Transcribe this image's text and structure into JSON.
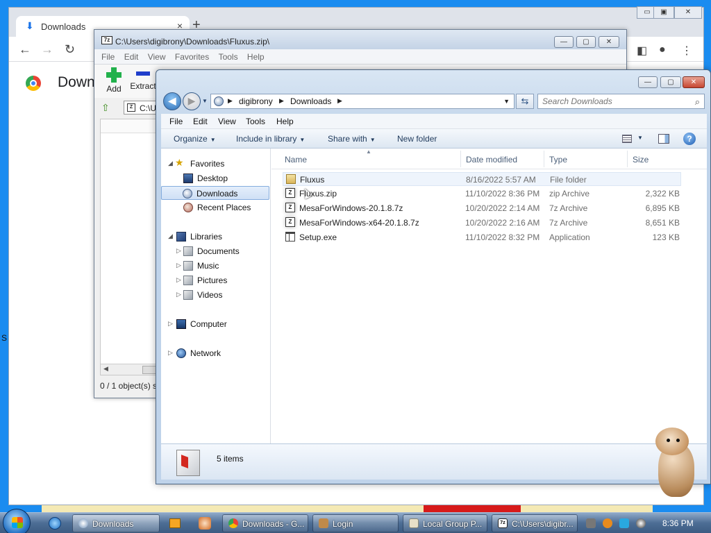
{
  "chrome": {
    "tab_title": "Downloads",
    "tab_close": "×",
    "new_tab": "+",
    "back": "←",
    "forward": "→",
    "reload": "↻",
    "heading": "Downloads",
    "win_min": "▭",
    "win_max": "▣",
    "win_close": "✕",
    "menu_dots": "⋮"
  },
  "zip7": {
    "title": "C:\\Users\\digibrony\\Downloads\\Fluxus.zip\\",
    "icon_label": "7z",
    "menu": [
      "File",
      "Edit",
      "View",
      "Favorites",
      "Tools",
      "Help"
    ],
    "add_label": "Add",
    "extract_label": "Extract",
    "address": "C:\\U",
    "status": "0 / 1 object(s) s"
  },
  "explorer": {
    "window_min": "—",
    "window_max": "▢",
    "window_close": "✕",
    "back": "◀",
    "forward": "▶",
    "address_crumbs": [
      "digibrony",
      "Downloads"
    ],
    "refresh": "⇆",
    "search_placeholder": "Search Downloads",
    "menu": [
      "File",
      "Edit",
      "View",
      "Tools",
      "Help"
    ],
    "commands": {
      "organize": "Organize",
      "include": "Include in library",
      "share": "Share with",
      "new_folder": "New folder",
      "help": "?"
    },
    "nav": {
      "favorites": "Favorites",
      "desktop": "Desktop",
      "downloads": "Downloads",
      "recent": "Recent Places",
      "libraries": "Libraries",
      "documents": "Documents",
      "music": "Music",
      "pictures": "Pictures",
      "videos": "Videos",
      "computer": "Computer",
      "network": "Network"
    },
    "columns": {
      "name": "Name",
      "date": "Date modified",
      "type": "Type",
      "size": "Size"
    },
    "files": [
      {
        "name": "Fluxus",
        "date": "8/16/2022 5:57 AM",
        "type": "File folder",
        "size": ""
      },
      {
        "name": "Fluxus.zip",
        "date": "11/10/2022 8:36 PM",
        "type": "zip Archive",
        "size": "2,322 KB"
      },
      {
        "name": "MesaForWindows-20.1.8.7z",
        "date": "10/20/2022 2:14 AM",
        "type": "7z Archive",
        "size": "6,895 KB"
      },
      {
        "name": "MesaForWindows-x64-20.1.8.7z",
        "date": "10/20/2022 2:16 AM",
        "type": "7z Archive",
        "size": "8,651 KB"
      },
      {
        "name": "Setup.exe",
        "date": "11/10/2022 8:32 PM",
        "type": "Application",
        "size": "123 KB"
      }
    ],
    "item_count": "5 items"
  },
  "taskbar": {
    "items": [
      "Downloads",
      "Downloads - G...",
      "Login",
      "Local Group P...",
      "C:\\Users\\digibr..."
    ],
    "clock": "8:36 PM"
  },
  "desktop_s": "S"
}
